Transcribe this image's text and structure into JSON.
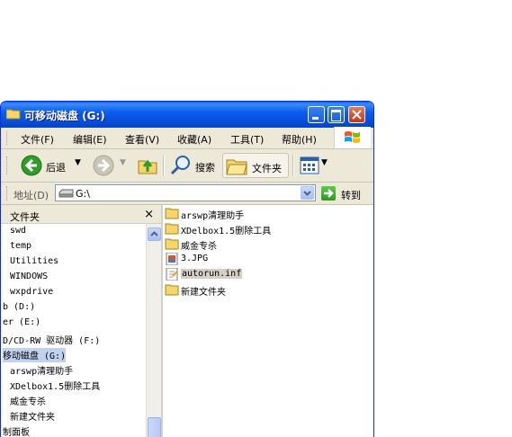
{
  "window": {
    "title": "可移动磁盘 (G:)"
  },
  "menu": [
    "文件(F)",
    "编辑(E)",
    "查看(V)",
    "收藏(A)",
    "工具(T)",
    "帮助(H)"
  ],
  "toolbar": {
    "back": "后退",
    "search": "搜索",
    "folders": "文件夹"
  },
  "address": {
    "label": "地址(D)",
    "value": "G:\\",
    "go": "转到"
  },
  "left_pane": {
    "title": "文件夹",
    "close": "×",
    "tree": [
      "swd",
      "temp",
      "Utilities",
      "WINDOWS",
      "wxpdrive",
      "b (D:)",
      "er (E:)",
      "D/CD-RW 驱动器 (F:)",
      "移动磁盘 (G:)",
      "arswp清理助手",
      "XDelbox1.5删除工具",
      "威金专杀",
      "新建文件夹",
      "制面板"
    ]
  },
  "files": [
    {
      "name": "arswp清理助手",
      "type": "folder"
    },
    {
      "name": "XDelbox1.5删除工具",
      "type": "folder"
    },
    {
      "name": "威金专杀",
      "type": "folder"
    },
    {
      "name": "3.JPG",
      "type": "image"
    },
    {
      "name": "autorun.inf",
      "type": "inf"
    },
    {
      "name": "新建文件夹",
      "type": "folder"
    }
  ]
}
